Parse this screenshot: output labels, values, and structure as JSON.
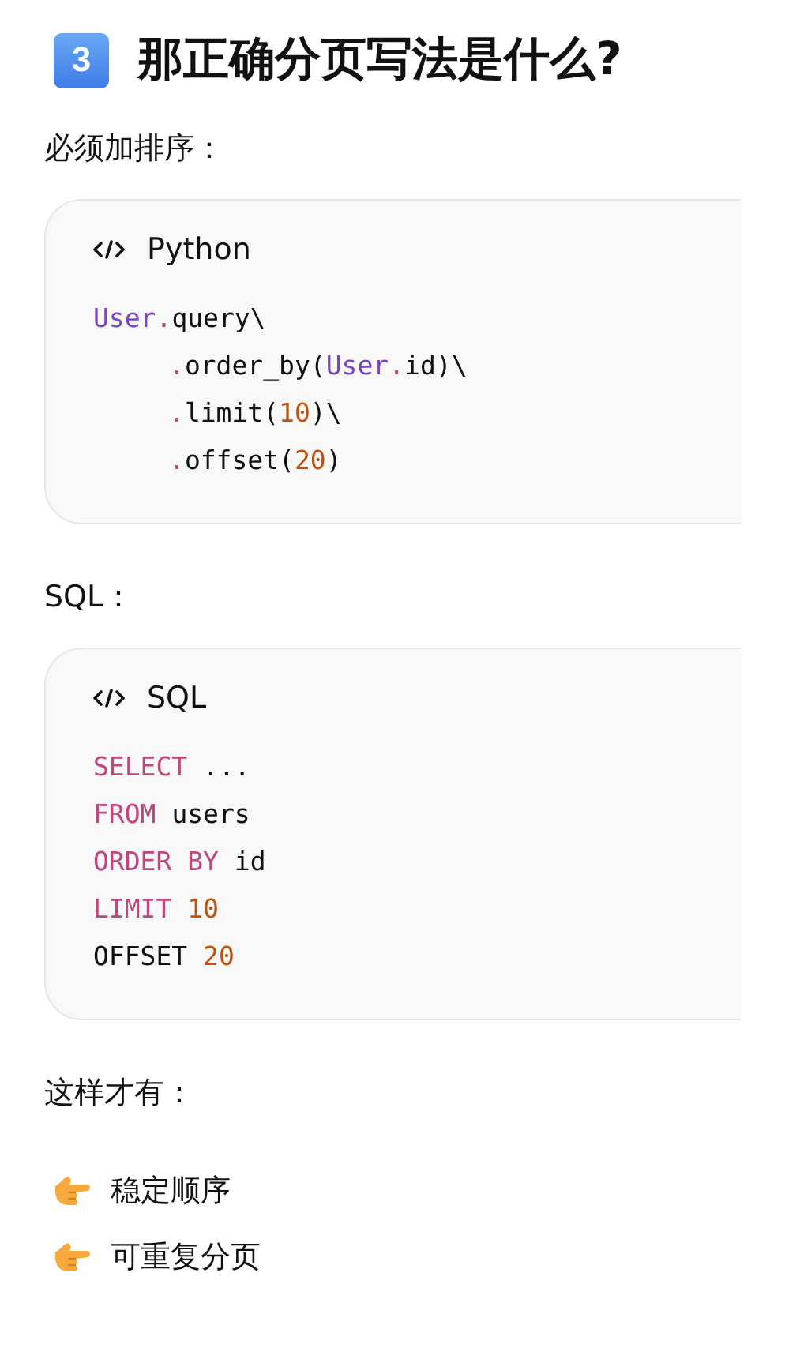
{
  "heading": {
    "number": "3",
    "text": "那正确分页写法是什么?"
  },
  "blocks": [
    {
      "kind": "paragraph",
      "text": "必须加排序："
    },
    {
      "kind": "code",
      "language": "Python",
      "lines": [
        {
          "words": [
            [
              {
                "kind": "class",
                "text": "User"
              },
              {
                "kind": "member",
                "text": ".query\\"
              }
            ]
          ],
          "children": [
            {
              "words": [
                [
                  {
                    "kind": "member",
                    "text": ".order_by("
                  },
                  {
                    "kind": "class",
                    "text": "User"
                  },
                  {
                    "kind": "member",
                    "text": ".id)\\"
                  }
                ]
              ]
            },
            {
              "words": [
                [
                  {
                    "kind": "member",
                    "text": ".limit("
                  },
                  {
                    "kind": "number",
                    "text": "10"
                  },
                  {
                    "kind": "plain",
                    "text": ")\\"
                  }
                ]
              ]
            },
            {
              "words": [
                [
                  {
                    "kind": "member",
                    "text": ".offset("
                  },
                  {
                    "kind": "number",
                    "text": "20"
                  },
                  {
                    "kind": "plain",
                    "text": ")"
                  }
                ]
              ]
            }
          ]
        }
      ]
    },
    {
      "kind": "paragraph",
      "text": "SQL："
    },
    {
      "kind": "code",
      "language": "SQL",
      "lines": [
        {
          "words": [
            [
              {
                "kind": "keyword",
                "text": "SELECT"
              }
            ],
            [
              {
                "kind": "plain",
                "text": "..."
              }
            ]
          ]
        },
        {
          "words": [
            [
              {
                "kind": "keyword",
                "text": "FROM"
              }
            ],
            [
              {
                "kind": "plain",
                "text": "users"
              }
            ]
          ]
        },
        {
          "words": [
            [
              {
                "kind": "keyword",
                "text": "ORDER BY"
              }
            ],
            [
              {
                "kind": "plain",
                "text": "id"
              }
            ]
          ]
        },
        {
          "words": [
            [
              {
                "kind": "keyword",
                "text": "LIMIT"
              }
            ],
            [
              {
                "kind": "number",
                "text": "10"
              }
            ]
          ]
        },
        {
          "words": [
            [
              {
                "kind": "plain",
                "text": "OFFSET"
              }
            ],
            [
              {
                "kind": "number",
                "text": "20"
              }
            ]
          ]
        }
      ]
    },
    {
      "kind": "paragraph",
      "text": "这样才有："
    },
    {
      "kind": "bullets",
      "items": [
        "稳定顺序",
        "可重复分页"
      ]
    }
  ]
}
